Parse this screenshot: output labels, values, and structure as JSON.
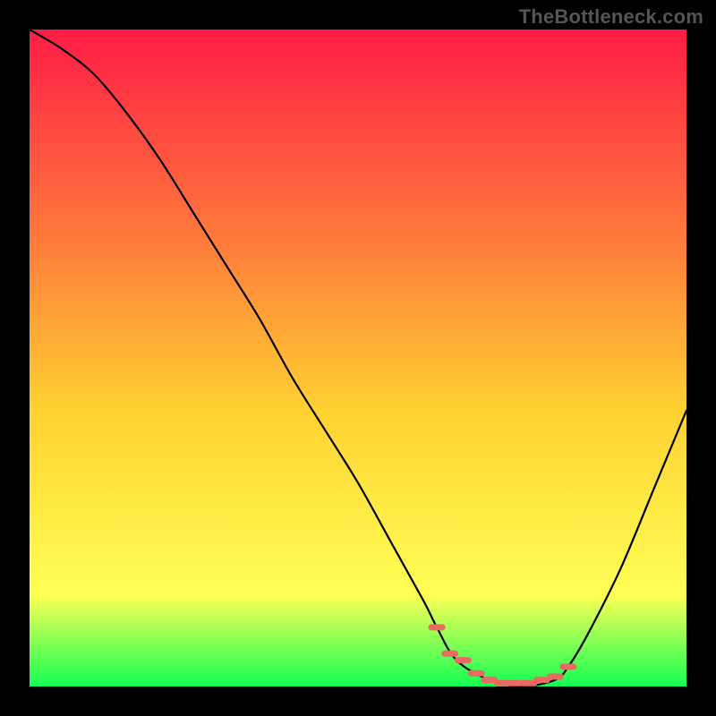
{
  "watermark": "TheBottleneck.com",
  "colors": {
    "gradient_top": "#ff1c46",
    "gradient_mid1": "#ff7a3b",
    "gradient_mid2": "#ffd131",
    "gradient_mid3": "#ffff55",
    "gradient_bottom": "#13ff54",
    "curve": "#000000",
    "marker": "#e86a62",
    "background": "#000000"
  },
  "chart_data": {
    "type": "line",
    "title": "",
    "xlabel": "",
    "ylabel": "",
    "xlim": [
      0,
      100
    ],
    "ylim": [
      0,
      100
    ],
    "grid": false,
    "legend": false,
    "series": [
      {
        "name": "bottleneck-curve",
        "x": [
          0,
          5,
          10,
          15,
          20,
          25,
          30,
          35,
          40,
          45,
          50,
          55,
          60,
          62,
          65,
          70,
          75,
          80,
          82,
          85,
          90,
          95,
          100
        ],
        "y": [
          100,
          97,
          93,
          87,
          80,
          72,
          64,
          56,
          47,
          39,
          31,
          22,
          13,
          9,
          4,
          1,
          0,
          1,
          3,
          8,
          18,
          30,
          42
        ]
      }
    ],
    "markers": {
      "name": "highlight-band",
      "x": [
        62,
        64,
        66,
        68,
        70,
        72,
        74,
        76,
        78,
        80,
        82
      ],
      "y": [
        9,
        5,
        4,
        2,
        1,
        0.5,
        0.5,
        0.5,
        1,
        1.5,
        3
      ]
    },
    "annotations": []
  }
}
